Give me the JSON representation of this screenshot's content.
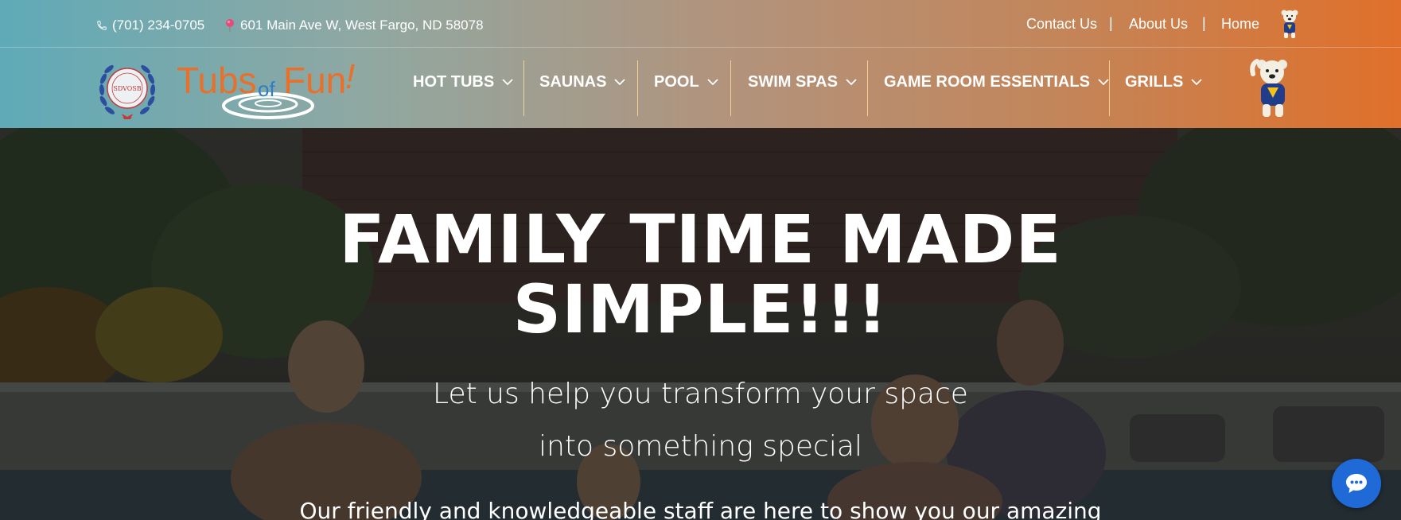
{
  "topbar": {
    "phone": "(701) 234-0705",
    "address": "601 Main Ave W, West Fargo, ND 58078",
    "links": [
      {
        "label": "Contact Us"
      },
      {
        "label": "About Us"
      },
      {
        "label": "Home"
      }
    ],
    "separator": "|"
  },
  "brand": {
    "logo_text_1": "Tubs",
    "logo_text_2": "of",
    "logo_text_3": "Fun",
    "logo_text_4": "!",
    "seal_text": "SDVOSB"
  },
  "nav": {
    "items": [
      {
        "label": "HOT TUBS"
      },
      {
        "label": "SAUNAS"
      },
      {
        "label": "POOL"
      },
      {
        "label": "SWIM SPAS"
      },
      {
        "label": "GAME ROOM ESSENTIALS"
      },
      {
        "label": "GRILLS"
      }
    ]
  },
  "hero": {
    "title_line1": "FAMILY TIME MADE",
    "title_line2": "SIMPLE!!!",
    "subtitle_line1": "Let us help you transform your space",
    "subtitle_line2": "into something special",
    "body": "Our friendly and knowledgeable staff are here to show you our amazing"
  },
  "colors": {
    "header_gradient_start": "#5faab8",
    "header_gradient_end": "#e0702b",
    "logo_orange": "#e8702a",
    "logo_blue": "#2f7fc7",
    "chat_button": "#1f6ad6"
  },
  "icons": {
    "phone": "phone-icon",
    "address": "map-pin-icon",
    "dropdown": "chevron-down-icon",
    "chat": "chat-bubble-icon"
  }
}
